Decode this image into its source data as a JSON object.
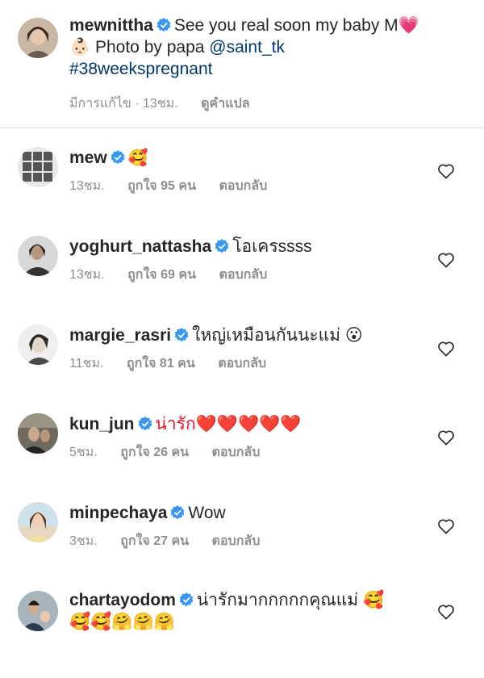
{
  "caption": {
    "username": "mewnittha",
    "text_line1": "See you real soon my baby M💗",
    "text_line2_prefix": "👶🏻 Photo by papa ",
    "mention": "@saint_tk",
    "hashtag": "#38weekspregnant",
    "edited": "มีการแก้ไข",
    "dot": "·",
    "time": "13ชม.",
    "translate": "ดูคำแปล"
  },
  "comments": [
    {
      "username": "mew",
      "text": "🥰",
      "time": "13ชม.",
      "likes": "ถูกใจ 95 คน",
      "reply": "ตอบกลับ"
    },
    {
      "username": "yoghurt_nattasha",
      "text": "โอเครssss",
      "time": "13ชม.",
      "likes": "ถูกใจ 69 คน",
      "reply": "ตอบกลับ"
    },
    {
      "username": "margie_rasri",
      "text": "ใหญ่เหมือนกันนะแม่ 😮",
      "time": "11ชม.",
      "likes": "ถูกใจ 81 คน",
      "reply": "ตอบกลับ"
    },
    {
      "username": "kun_jun",
      "text": "น่ารัก❤️❤️❤️❤️❤️",
      "time": "5ชม.",
      "likes": "ถูกใจ 26 คน",
      "reply": "ตอบกลับ"
    },
    {
      "username": "minpechaya",
      "text": "Wow",
      "time": "3ชม.",
      "likes": "ถูกใจ 27 คน",
      "reply": "ตอบกลับ"
    },
    {
      "username": "chartayodom",
      "text": "น่ารักมากกกกกคุณแม่ 🥰",
      "text2": "🥰🥰🤗🤗🤗",
      "time": "",
      "likes": "",
      "reply": ""
    }
  ],
  "icons": {
    "verified": "verified-badge-icon",
    "like": "heart-outline-icon"
  },
  "colors": {
    "verified": "#3897f0",
    "link": "#00376b",
    "meta": "#8e8e8e",
    "divider": "#dbdbdb"
  }
}
